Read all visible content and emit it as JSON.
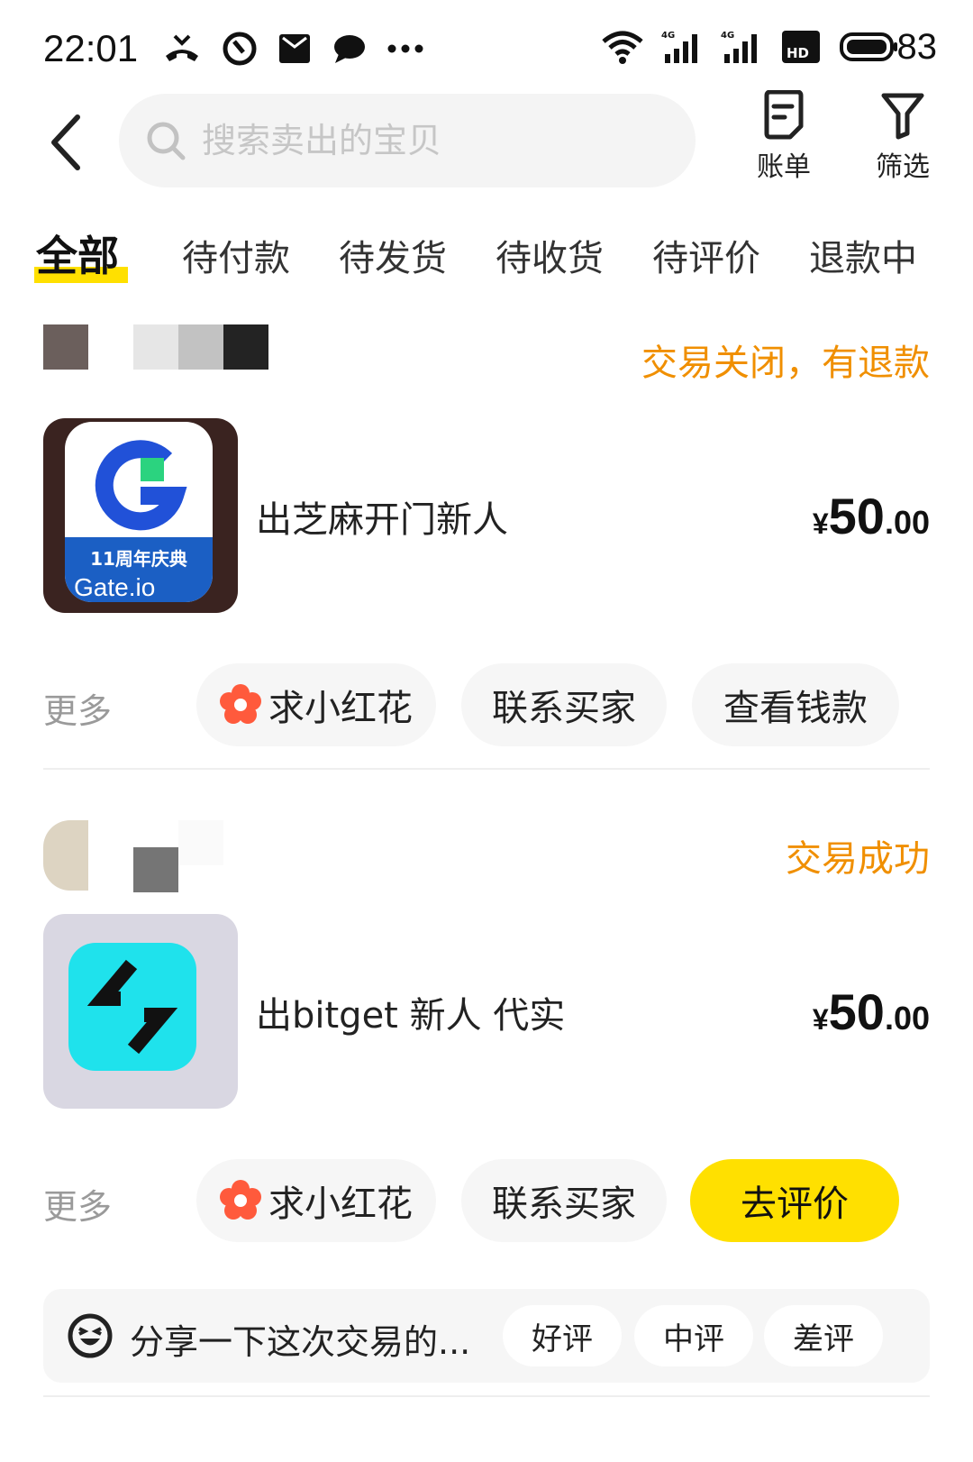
{
  "status_bar": {
    "time": "22:01",
    "battery": "83",
    "icons_left": [
      "missed-call-icon",
      "no-disturb-icon",
      "mail-icon",
      "chat-bubble-icon",
      "more-dots-icon"
    ],
    "icons_right": [
      "wifi-icon",
      "signal-4g-icon",
      "signal-4g-icon",
      "hd-icon",
      "battery-icon"
    ]
  },
  "header": {
    "search_placeholder": "搜索卖出的宝贝",
    "bill_label": "账单",
    "filter_label": "筛选"
  },
  "tabs": [
    {
      "label": "全部",
      "active": true
    },
    {
      "label": "待付款",
      "active": false
    },
    {
      "label": "待发货",
      "active": false
    },
    {
      "label": "待收货",
      "active": false
    },
    {
      "label": "待评价",
      "active": false
    },
    {
      "label": "退款中",
      "active": false
    }
  ],
  "orders": [
    {
      "status": "交易关闭，有退款",
      "title": "出芝麻开门新人",
      "price_symbol": "¥",
      "price_int": "50",
      "price_dec": ".00",
      "thumb_text_top": "11周年庆典",
      "thumb_text_bottom": "Gate.io",
      "more_label": "更多",
      "actions": [
        "求小红花",
        "联系买家",
        "查看钱款"
      ]
    },
    {
      "status": "交易成功",
      "title": "出bitget 新人 代实",
      "price_symbol": "¥",
      "price_int": "50",
      "price_dec": ".00",
      "more_label": "更多",
      "actions": [
        "求小红花",
        "联系买家",
        "去评价"
      ]
    }
  ],
  "review": {
    "prompt": "分享一下这次交易的...",
    "options": [
      "好评",
      "中评",
      "差评"
    ]
  },
  "colors": {
    "accent_yellow": "#ffe000",
    "status_orange": "#f08f00",
    "flower_red": "#ff5a3c"
  }
}
